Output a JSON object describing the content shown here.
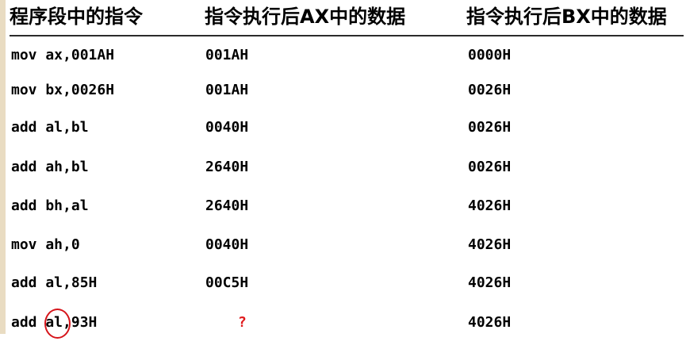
{
  "headers": [
    "程序段中的指令",
    "指令执行后AX中的数据",
    "指令执行后BX中的数据"
  ],
  "rows": [
    {
      "instr": "mov ax,001AH",
      "ax": "001AH",
      "bx": "0000H"
    },
    {
      "instr": "mov bx,0026H",
      "ax": "001AH",
      "bx": "0026H"
    },
    {
      "instr": "add al,bl",
      "ax": "0040H",
      "bx": "0026H"
    },
    {
      "instr": "add ah,bl",
      "ax": "2640H",
      "bx": "0026H"
    },
    {
      "instr": "add bh,al",
      "ax": "2640H",
      "bx": "4026H"
    },
    {
      "instr": "mov ah,0",
      "ax": "0040H",
      "bx": "4026H"
    },
    {
      "instr": "add al,85H",
      "ax": "00C5H",
      "bx": "4026H"
    },
    {
      "instr": "add al,93H",
      "ax": "?",
      "bx": "4026H"
    }
  ],
  "colors": {
    "question_mark": "#e0191b",
    "circle_annotation": "#d6141a",
    "left_bar": "#e9dcc2"
  }
}
